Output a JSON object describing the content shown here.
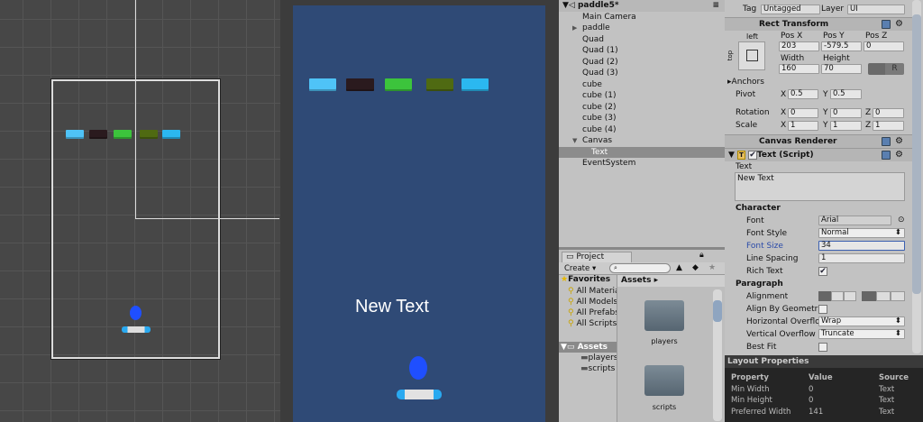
{
  "scene": {
    "bricks": [
      "#4fc3f7",
      "#2a1a1e",
      "#3cc43c",
      "#4f6a12",
      "#2bb8f0"
    ]
  },
  "game": {
    "text": "New Text",
    "bricks": [
      "#4fc3f7",
      "#2a1a1e",
      "#3cc43c",
      "#4f6a12",
      "#2bb8f0"
    ]
  },
  "hierarchy": {
    "scene_name": "paddle5*",
    "items": [
      "Main Camera",
      "paddle",
      "Quad",
      "Quad (1)",
      "Quad (2)",
      "Quad (3)",
      "cube",
      "cube (1)",
      "cube (2)",
      "cube (3)",
      "cube (4)",
      "Canvas",
      "Text",
      "EventSystem"
    ],
    "selected": "Text"
  },
  "project": {
    "tab": "Project",
    "create": "Create",
    "favorites": "Favorites",
    "fav_items": [
      "All Materials",
      "All Models",
      "All Prefabs",
      "All Scripts"
    ],
    "assets": "Assets",
    "asset_folders": [
      "players",
      "scripts"
    ],
    "breadcrumb": "Assets",
    "grid_items": [
      "players",
      "scripts"
    ]
  },
  "inspector": {
    "tag_label": "Tag",
    "tag": "Untagged",
    "layer_label": "Layer",
    "layer": "UI",
    "rect": {
      "title": "Rect Transform",
      "anchor_h": "left",
      "anchor_v": "top",
      "posx_l": "Pos X",
      "posy_l": "Pos Y",
      "posz_l": "Pos Z",
      "posx": "203",
      "posy": "-579.5",
      "posz": "0",
      "width_l": "Width",
      "height_l": "Height",
      "width": "160",
      "height": "70",
      "r": "R",
      "anchors": "Anchors",
      "pivot": "Pivot",
      "pivot_x": "0.5",
      "pivot_y": "0.5",
      "rotation": "Rotation",
      "rot_x": "0",
      "rot_y": "0",
      "rot_z": "0",
      "scale": "Scale",
      "sc_x": "1",
      "sc_y": "1",
      "sc_z": "1",
      "x": "X",
      "y": "Y",
      "z": "Z"
    },
    "canvas_renderer": "Canvas Renderer",
    "text_script": {
      "title": "Text (Script)",
      "text_label": "Text",
      "text_value": "New Text",
      "character": "Character",
      "font_l": "Font",
      "font": "Arial",
      "style_l": "Font Style",
      "style": "Normal",
      "size_l": "Font Size",
      "size": "34",
      "spacing_l": "Line Spacing",
      "spacing": "1",
      "rich_l": "Rich Text",
      "paragraph": "Paragraph",
      "align_l": "Alignment",
      "geom_l": "Align By Geometr",
      "hover_l": "Horizontal Overflo",
      "hover": "Wrap",
      "vover_l": "Vertical Overflow",
      "vover": "Truncate",
      "best_l": "Best Fit"
    },
    "layout": {
      "title": "Layout Properties",
      "headers": [
        "Property",
        "Value",
        "Source"
      ],
      "rows": [
        [
          "Min Width",
          "0",
          "Text"
        ],
        [
          "Min Height",
          "0",
          "Text"
        ],
        [
          "Preferred Width",
          "141",
          "Text"
        ]
      ]
    }
  }
}
